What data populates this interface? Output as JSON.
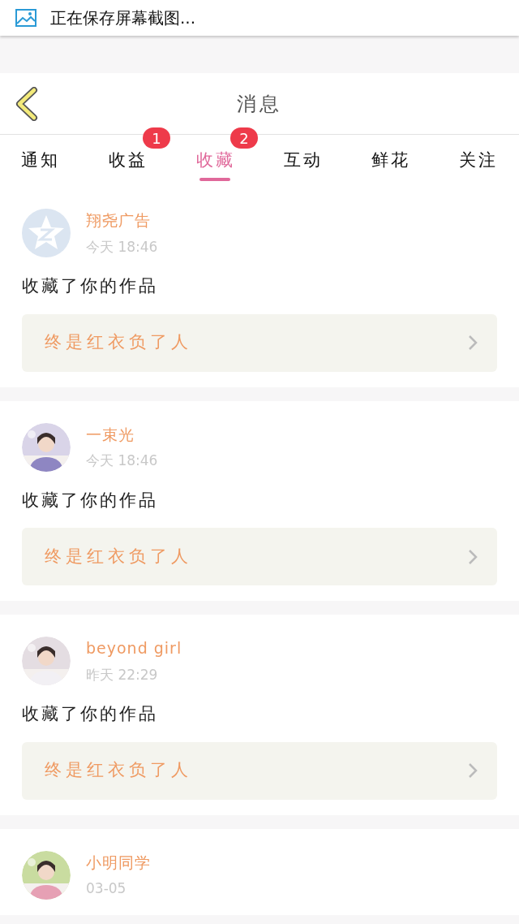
{
  "notification": {
    "text": "正在保存屏幕截图..."
  },
  "header": {
    "title": "消息"
  },
  "tabs": [
    {
      "label": "通知",
      "selected": false
    },
    {
      "label": "收益",
      "selected": false,
      "badge": "1"
    },
    {
      "label": "收藏",
      "selected": true,
      "badge": "2"
    },
    {
      "label": "互动",
      "selected": false
    },
    {
      "label": "鲜花",
      "selected": false
    },
    {
      "label": "关注",
      "selected": false
    }
  ],
  "messages": [
    {
      "avatar": {
        "kind": "icon"
      },
      "name": "翔尧广告",
      "time": "今天 18:46",
      "text": "收藏了你的作品",
      "work": "终是红衣负了人"
    },
    {
      "name": "一束光",
      "time": "今天 18:46",
      "text": "收藏了你的作品",
      "work": "终是红衣负了人"
    },
    {
      "name": "beyond girl",
      "time": "昨天 22:29",
      "text": "收藏了你的作品",
      "work": "终是红衣负了人"
    },
    {
      "name": "小明同学",
      "time": "03-05"
    }
  ]
}
